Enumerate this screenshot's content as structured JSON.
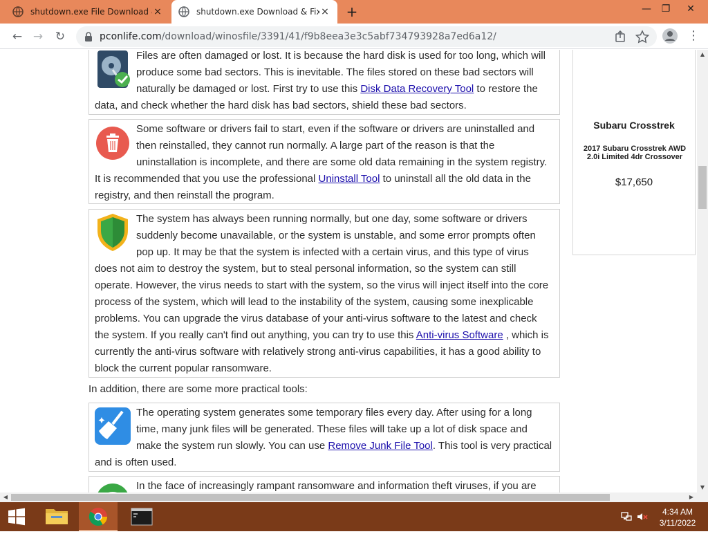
{
  "browser": {
    "tabs": [
      {
        "title": "shutdown.exe File Download & Fix",
        "close": "×"
      },
      {
        "title": "shutdown.exe Download & Fix For",
        "close": "×"
      }
    ],
    "new_tab": "+",
    "window_controls": {
      "minimize": "—",
      "restore": "❐",
      "close": "✕"
    },
    "nav": {
      "back": "←",
      "forward": "→",
      "reload": "↻"
    },
    "address": {
      "host": "pconlife.com",
      "path": "/download/winosfile/3391/41/f9b8eea3e3c5abf734793928a7ed6a12/"
    },
    "menu": "⋮"
  },
  "article": {
    "boxes": [
      {
        "icon": "hard-disk-icon",
        "text_before": "Files are often damaged or lost. It is because the hard disk is used for too long, which will produce some bad sectors. This is inevitable. The files stored on these bad sectors will naturally be damaged or lost. First try to use this ",
        "link": "Disk Data Recovery Tool",
        "text_after": " to restore the data, and check whether the hard disk has bad sectors, shield these bad sectors."
      },
      {
        "icon": "trash-can-icon",
        "text_before": "Some software or drivers fail to start, even if the software or drivers are uninstalled and then reinstalled, they cannot run normally. A large part of the reason is that the uninstallation is incomplete, and there are some old data remaining in the system registry. It is recommended that you use the professional ",
        "link": "Uninstall Tool",
        "text_after": " to uninstall all the old data in the registry, and then reinstall the program."
      },
      {
        "icon": "shield-icon",
        "text_before": "The system has always been running normally, but one day, some software or drivers suddenly become unavailable, or the system is unstable, and some error prompts often pop up. It may be that the system is infected with a certain virus, and this type of virus does not aim to destroy the system, but to steal personal information, so the system can still operate. However, the virus needs to start with the system, so the virus will inject itself into the core process of the system, which will lead to the instability of the system, causing some inexplicable problems. You can upgrade the virus database of your anti-virus software to the latest and check the system. If you really can't find out anything, you can try to use this ",
        "link": "Anti-virus Software",
        "text_after": " , which is currently the anti-virus software with relatively strong anti-virus capabilities, it has a good ability to block the current popular ransomware."
      }
    ],
    "intro": "In addition, there are some more practical tools:",
    "tool_boxes": [
      {
        "icon": "broom-icon",
        "text_before": "The operating system generates some temporary files every day. After using for a long time, many junk files will be generated. These files will take up a lot of disk space and make the system run slowly. You can use ",
        "link": "Remove Junk File Tool",
        "text_after": ". This tool is very practical and is often used."
      },
      {
        "icon": "green-globe-icon",
        "text_before": "In the face of increasingly rampant ransomware and information theft viruses, if you are",
        "link": "",
        "text_after": ""
      }
    ]
  },
  "ad": {
    "title": "Subaru Crosstrek",
    "subtitle": "2017 Subaru Crosstrek AWD 2.0i Limited 4dr Crossover",
    "price": "$17,650"
  },
  "taskbar": {
    "time": "4:34 AM",
    "date": "3/11/2022"
  },
  "colors": {
    "titlebar": "#e8885b",
    "taskbar": "#7a3a18",
    "link": "#1a0dab"
  }
}
